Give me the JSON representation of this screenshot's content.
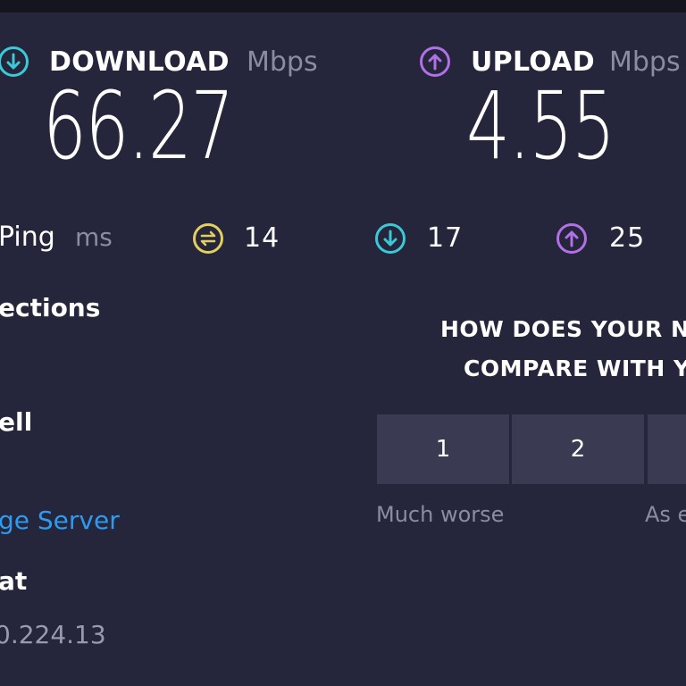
{
  "download": {
    "label": "DOWNLOAD",
    "unit": "Mbps",
    "value": "66.27",
    "icon": "arrow-down-circle-icon",
    "color": "#3cc9d6"
  },
  "upload": {
    "label": "UPLOAD",
    "unit": "Mbps",
    "value": "4.55",
    "icon": "arrow-up-circle-icon",
    "color": "#b170e6"
  },
  "ping": {
    "label": "Ping",
    "unit": "ms",
    "idle": "14",
    "download": "17",
    "upload": "25",
    "idle_color": "#e2cf5e"
  },
  "details": {
    "connections_label": "ections",
    "isp_label": "ell",
    "server_link": "ge Server",
    "location_label": "at",
    "ip_address": "0.224.13"
  },
  "survey": {
    "line1": "HOW DOES YOUR N",
    "line2": "COMPARE WITH Y",
    "options": [
      "1",
      "2",
      ""
    ],
    "caption_low": "Much worse",
    "caption_mid": "As e"
  },
  "colors": {
    "background": "#25253b",
    "link": "#2d9bf0",
    "box": "#3a3a52"
  }
}
